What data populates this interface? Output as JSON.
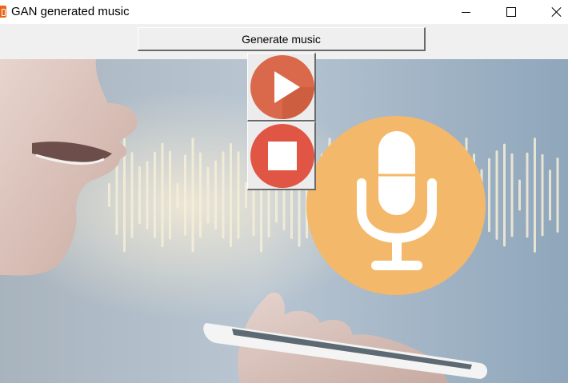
{
  "window": {
    "title": "GAN generated music",
    "icon": "app-icon",
    "controls": [
      "minimize-icon",
      "maximize-icon",
      "close-icon"
    ]
  },
  "toolbar": {
    "generate_label": "Generate music"
  },
  "media": {
    "play_icon": "play-icon",
    "stop_icon": "stop-icon",
    "play_color": "#d9694a",
    "stop_color": "#e05544"
  },
  "background": {
    "description_icon": "microphone-icon",
    "mic_circle_color": "#f3b86a"
  }
}
